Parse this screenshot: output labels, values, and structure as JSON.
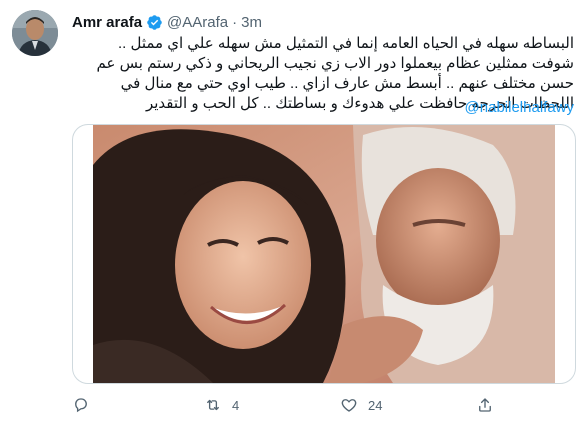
{
  "tweet": {
    "author_name": "Amr arafa",
    "handle": "@AArafa",
    "separator": "·",
    "time": "3m",
    "text_lines": [
      "البساطه سهله في الحياه العامه إنما في التمثيل مش سهله علي اي ممثل ..",
      "شوفت ممثلين عظام بيعملوا دور الاب زي نجيب الريحاني و ذكي رستم بس عم",
      "حسن مختلف عنهم .. أبسط مش عارف ازاي .. طيب اوي حتي مع منال في",
      "اللحظات الحرجه حافظت علي هدوءك و بساطتك .. كل الحب و التقدير"
    ],
    "mention": "@nabilelhalfawy",
    "actions": {
      "reply_count": "",
      "retweet_count": "4",
      "like_count": "24"
    }
  },
  "icons": {
    "verified": "verified-badge-icon",
    "reply": "reply-icon",
    "retweet": "retweet-icon",
    "like": "heart-icon",
    "share": "share-icon"
  },
  "colors": {
    "accent": "#1d9bf0",
    "secondary_text": "#536471",
    "border": "#cfd9de"
  }
}
